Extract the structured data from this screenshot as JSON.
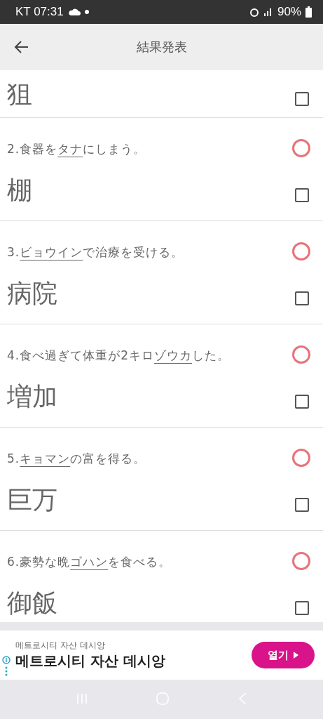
{
  "status_bar": {
    "carrier_time": "KT 07:31",
    "battery": "90%"
  },
  "header": {
    "title": "結果発表"
  },
  "items": [
    {
      "answer": "狙",
      "checked": false
    },
    {
      "question": {
        "prefix": "2.食器を",
        "target": "タナ",
        "suffix": "にしまう。"
      },
      "answer": "棚",
      "correct": true,
      "checked": false
    },
    {
      "question": {
        "prefix": "3.",
        "target": "ビョウイン",
        "suffix": "で治療を受ける。"
      },
      "answer": "病院",
      "correct": true,
      "checked": false
    },
    {
      "question": {
        "prefix": "4.食べ過ぎて体重が2キロ",
        "target": "ゾウカ",
        "suffix": "した。"
      },
      "answer": "増加",
      "correct": true,
      "checked": false
    },
    {
      "question": {
        "prefix": "5.",
        "target": "キョマン",
        "suffix": "の富を得る。"
      },
      "answer": "巨万",
      "correct": true,
      "checked": false
    },
    {
      "question": {
        "prefix": "6.豪勢な晩",
        "target": "ゴハン",
        "suffix": "を食べる。"
      },
      "answer": "御飯",
      "correct": true,
      "checked": false
    }
  ],
  "ad": {
    "caption": "메트로시티 자산 데시앙",
    "headline": "메트로시티 자산 데시앙",
    "button": "열기"
  }
}
